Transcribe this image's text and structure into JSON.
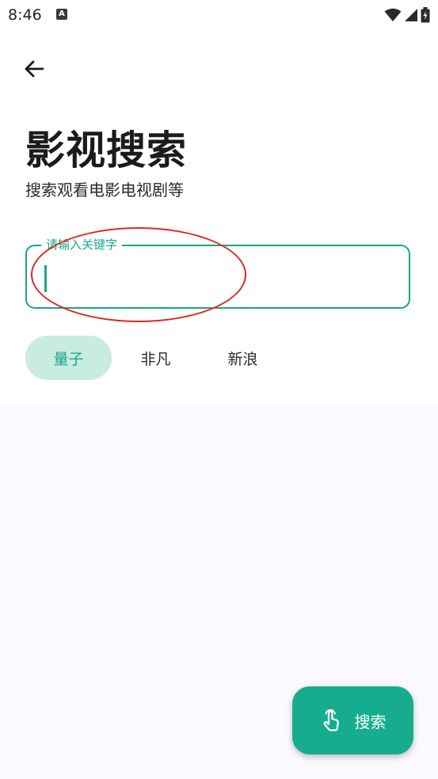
{
  "status_bar": {
    "time": "8:46",
    "notification_letter": "A"
  },
  "header": {
    "title": "影视搜索",
    "subtitle": "搜索观看电影电视剧等"
  },
  "search": {
    "label": "请输入关键字",
    "value": ""
  },
  "sources": {
    "tabs": [
      {
        "label": "量子",
        "selected": true
      },
      {
        "label": "非凡",
        "selected": false
      },
      {
        "label": "新浪",
        "selected": false
      }
    ]
  },
  "fab": {
    "label": "搜索",
    "icon": "tap-hand-icon"
  },
  "colors": {
    "accent": "#1aa58a",
    "chip_selected_bg": "#c8ebe2",
    "fab_bg": "#16ad8e",
    "annotation": "#e0271f"
  }
}
